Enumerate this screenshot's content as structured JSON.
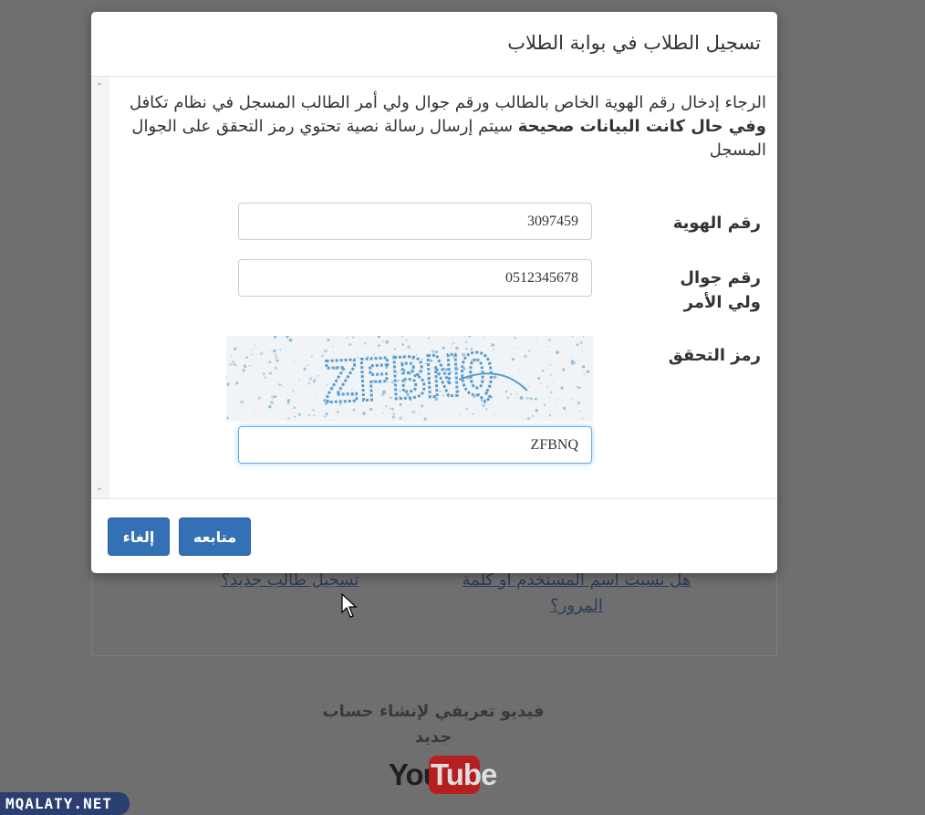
{
  "background": {
    "forgot_link": "هل نسيت اسم المستخدم او كلمة المرور؟",
    "register_link": "تسجيل طالب جديد؟",
    "video_caption": "فيديو تعريفي لإنشاء حساب جديد",
    "youtube": {
      "you": "You",
      "tube": "Tube"
    },
    "watermark": "MQALATY.NET"
  },
  "modal": {
    "title": "تسجيل الطلاب في بوابة الطلاب",
    "instructions": {
      "part1": "الرجاء إدخال رقم الهوية الخاص بالطالب ورقم جوال ولي أمر الطالب المسجل في نظام تكافل ",
      "bold": "وفي حال كانت البيانات صحيحة",
      "part2": " سيتم إرسال رسالة نصية تحتوي رمز التحقق على الجوال المسجل"
    },
    "fields": {
      "id_label": "رقم الهوية",
      "id_value": "3097459",
      "phone_label": "رقم جوال ولي الأمر",
      "phone_value": "0512345678",
      "captcha_label": "رمز التحقق",
      "captcha_image_text": "ZFBNQ",
      "captcha_value": "ZFBNQ"
    },
    "buttons": {
      "continue": "متابعه",
      "cancel": "إلغاء"
    }
  },
  "colors": {
    "primary_button": "#3470b5",
    "overlay": "#6f6f6f",
    "captcha_text": "#5a9ccf",
    "youtube_red": "#b51f1f"
  }
}
